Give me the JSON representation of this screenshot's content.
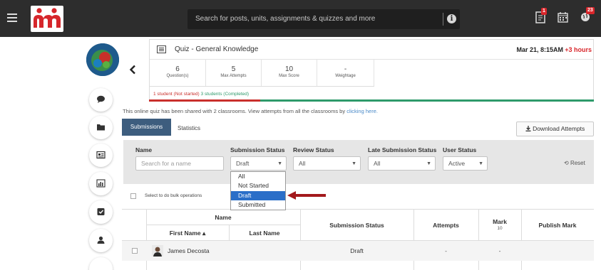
{
  "topbar": {
    "search_placeholder": "Search for posts, units, assignments & quizzes and more",
    "notifications_badge": "1",
    "alerts_badge": "23"
  },
  "quiz": {
    "title": "Quiz - General Knowledge",
    "date": "Mar 21, 8:15AM",
    "late": "+3 hours",
    "stats": [
      {
        "value": "6",
        "label": "Question(s)"
      },
      {
        "value": "5",
        "label": "Max Attempts"
      },
      {
        "value": "10",
        "label": "Max Score"
      },
      {
        "value": "-",
        "label": "Weightage"
      }
    ],
    "not_started": "1 student (Not started)",
    "completed": "3 students (Completed)",
    "progress_completed": 0.75
  },
  "share": {
    "text": "This online quiz has been shared with 2 classrooms. View attempts from all the classrooms by",
    "link": "clicking here."
  },
  "tabs": {
    "submissions": "Submissions",
    "statistics": "Statistics"
  },
  "download_label": "Download Attempts",
  "filters": {
    "name_label": "Name",
    "name_placeholder": "Search for a name",
    "submission_label": "Submission Status",
    "submission_value": "Draft",
    "review_label": "Review Status",
    "review_value": "All",
    "late_label": "Late Submission Status",
    "late_value": "All",
    "user_label": "User Status",
    "user_value": "Active",
    "reset": "Reset"
  },
  "dropdown_options": [
    "All",
    "Not Started",
    "Draft",
    "Submitted"
  ],
  "bulk_label": "Select to do bulk operations",
  "table": {
    "name_header": "Name",
    "first_name": "First Name ▴",
    "last_name": "Last Name",
    "submission_status": "Submission Status",
    "attempts": "Attempts",
    "mark": "Mark",
    "mark_max": "10",
    "publish_mark": "Publish Mark",
    "rows": [
      {
        "name": "James Decosta",
        "status": "Draft",
        "attempts": "-",
        "mark": "-"
      }
    ]
  },
  "colors": {
    "topbar": "#2d2d2d",
    "tab_active": "#3d5d7e",
    "late": "#d9262b",
    "progress_red": "#c9302c",
    "progress_green": "#2e9a6b",
    "dropdown_selected": "#2a6ec8"
  }
}
